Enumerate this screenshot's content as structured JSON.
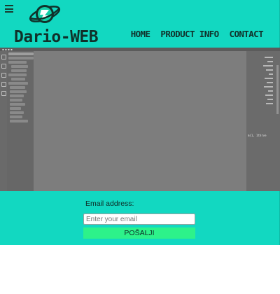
{
  "header": {
    "brand": "Dario-WEB",
    "menu_icon": "hamburger-icon",
    "logo_icon": "planet-logo-icon",
    "nav": [
      {
        "label": "HOME"
      },
      {
        "label": "PRODUCT INFO"
      },
      {
        "label": "CONTACT"
      }
    ]
  },
  "hero": {
    "image": "code-editor-screenshot",
    "code_snippet": "m(1, 1thrve"
  },
  "newsletter": {
    "label": "Email address:",
    "placeholder": "Enter your email",
    "value": "",
    "submit_label": "POŠALJI"
  },
  "colors": {
    "background": "#12d8c1",
    "button": "#2df28a",
    "text": "#10312a"
  }
}
